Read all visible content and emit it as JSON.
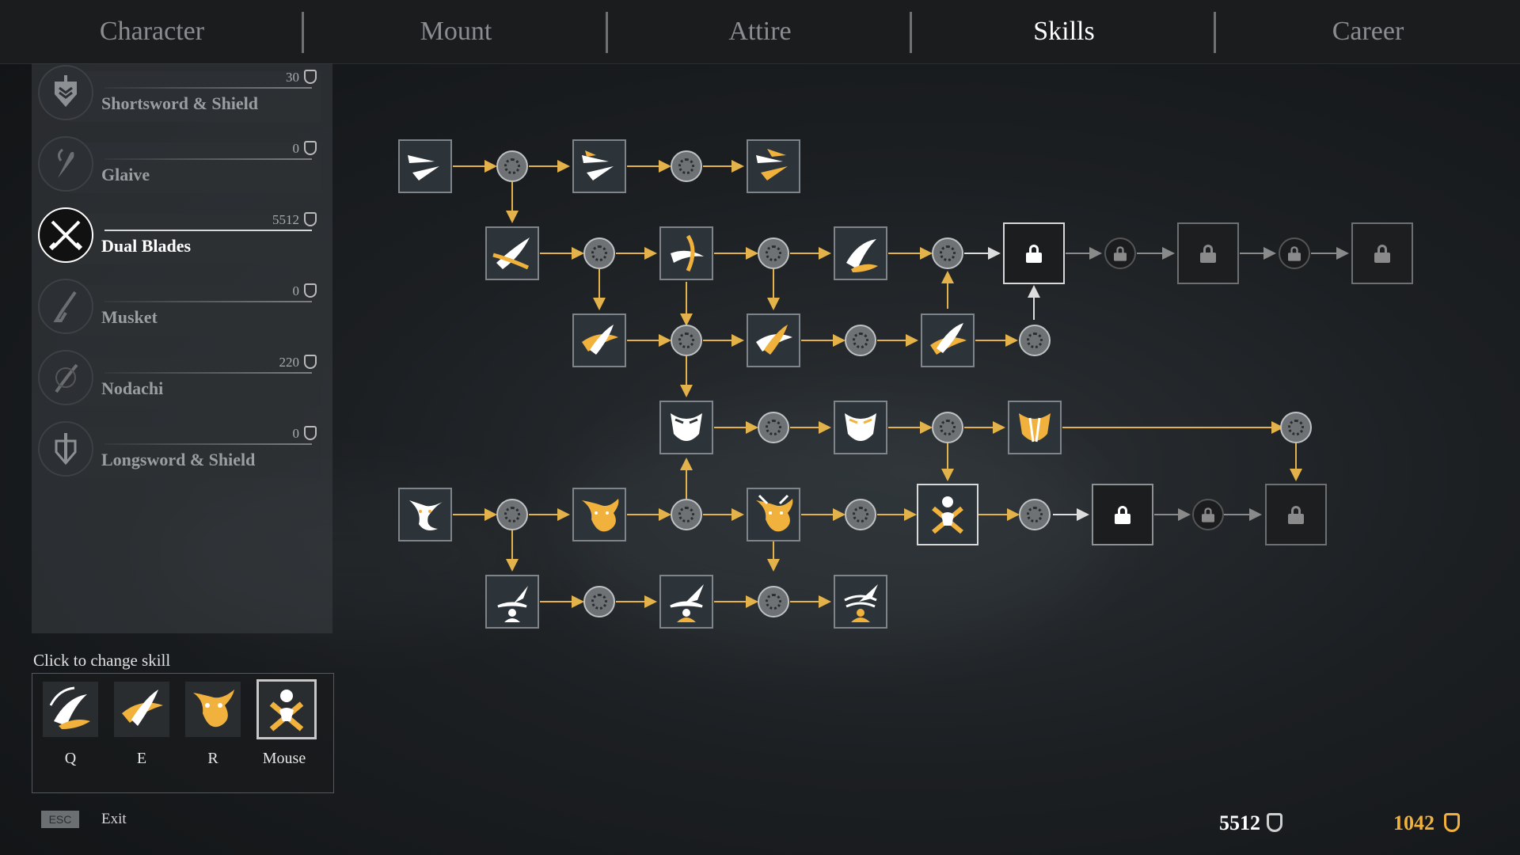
{
  "tabs": [
    {
      "label": "Character",
      "active": false
    },
    {
      "label": "Mount",
      "active": false
    },
    {
      "label": "Attire",
      "active": false
    },
    {
      "label": "Skills",
      "active": true
    },
    {
      "label": "Career",
      "active": false
    }
  ],
  "weapons": [
    {
      "name": "Shortsword & Shield",
      "points": "30",
      "icon": "shield-sword-icon"
    },
    {
      "name": "Glaive",
      "points": "0",
      "icon": "glaive-icon"
    },
    {
      "name": "Dual Blades",
      "points": "5512",
      "icon": "dual-blades-icon",
      "active": true
    },
    {
      "name": "Musket",
      "points": "0",
      "icon": "musket-icon"
    },
    {
      "name": "Nodachi",
      "points": "220",
      "icon": "nodachi-icon"
    },
    {
      "name": "Longsword & Shield",
      "points": "0",
      "icon": "longsword-shield-icon"
    }
  ],
  "slots": {
    "title": "Click to change skill",
    "items": [
      {
        "key": "Q",
        "icon": "swirl-blades-skill-icon"
      },
      {
        "key": "E",
        "icon": "spin-slash-skill-icon"
      },
      {
        "key": "R",
        "icon": "fire-beast-skill-icon"
      },
      {
        "key": "Mouse",
        "icon": "cross-blades-figure-skill-icon",
        "selected": true
      }
    ]
  },
  "footer": {
    "esc_key": "ESC",
    "exit_label": "Exit",
    "skill_points": "5512",
    "gold": "1042"
  },
  "colors": {
    "accent_gold": "#f0b23c",
    "connector_arrow": "#e4b24a",
    "locked_arrow": "#9a9a9a"
  }
}
